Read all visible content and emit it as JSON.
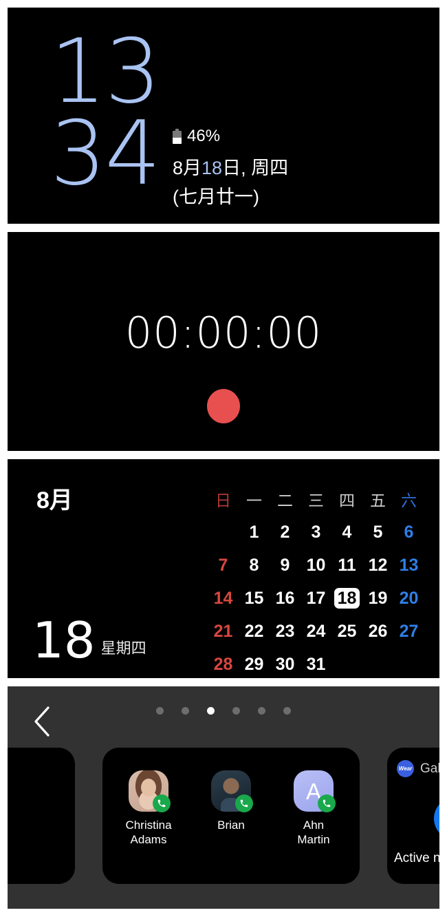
{
  "clock_widget": {
    "hours": "13",
    "minutes": "34",
    "battery_icon": "battery-icon",
    "battery_percent": "46%",
    "date_prefix": "8月",
    "date_day": "18",
    "date_suffix": "日, 周四",
    "lunar_date": "(七月廿一)",
    "digits_color": "#a9c3f2"
  },
  "stopwatch_widget": {
    "time": "00:00:00",
    "button_icon": "record-button",
    "button_color": "#e8504f"
  },
  "calendar_widget": {
    "month": "8月",
    "big_day": "18",
    "weekday": "星期四",
    "weekday_headers": [
      "日",
      "一",
      "二",
      "三",
      "四",
      "五",
      "六"
    ],
    "weeks": [
      [
        "",
        "1",
        "2",
        "3",
        "4",
        "5",
        "6"
      ],
      [
        "7",
        "8",
        "9",
        "10",
        "11",
        "12",
        "13"
      ],
      [
        "14",
        "15",
        "16",
        "17",
        "18",
        "19",
        "20"
      ],
      [
        "21",
        "22",
        "23",
        "24",
        "25",
        "26",
        "27"
      ],
      [
        "28",
        "29",
        "30",
        "31",
        "",
        "",
        ""
      ]
    ],
    "today": "18",
    "sunday_color": "#d8473f",
    "saturday_color": "#2f7fe6"
  },
  "carousel": {
    "back_icon": "chevron-left-icon",
    "dot_count": 6,
    "active_dot_index": 2,
    "main_card": {
      "contacts": [
        {
          "name": "Christina\nAdams",
          "line1": "Christina",
          "line2": "Adams",
          "avatar": "photo-avatar",
          "badge_icon": "phone-icon"
        },
        {
          "name": "Brian",
          "line1": "Brian",
          "line2": "",
          "avatar": "photo-avatar",
          "badge_icon": "phone-icon"
        },
        {
          "name": "Ahn Martin",
          "line1": "Ahn",
          "line2": "Martin",
          "avatar": "letter-avatar",
          "letter": "A",
          "badge_icon": "phone-icon"
        }
      ]
    },
    "next_card": {
      "app_badge": "Wear",
      "app_title": "Gala",
      "icon": "noise-canceling-icon",
      "label": "Active noi"
    }
  }
}
